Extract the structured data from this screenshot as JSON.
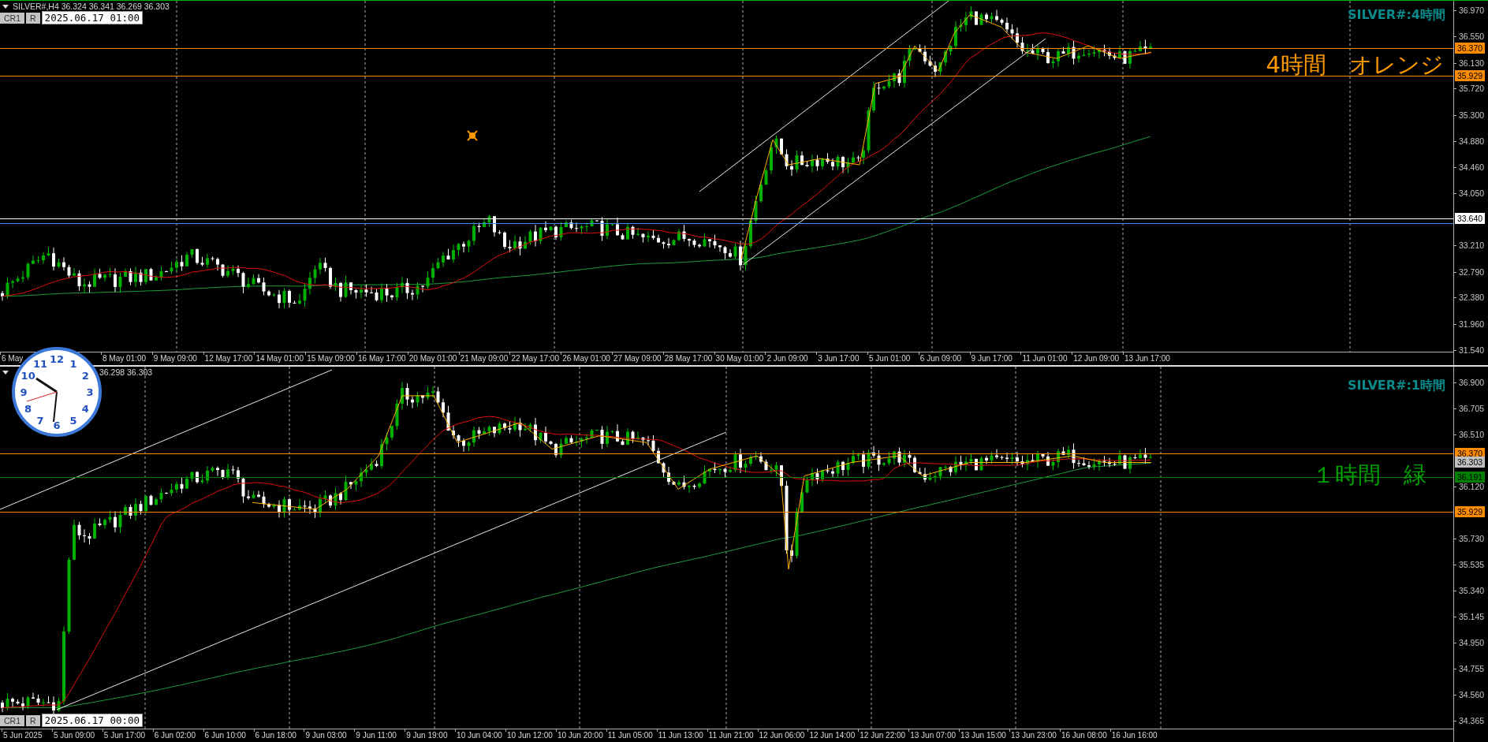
{
  "charts": [
    {
      "header": {
        "text": "SILVER#,H4 36.324 36.341 36.269 36.303"
      },
      "date_bar": {
        "buttons": [
          "CR1",
          "R"
        ],
        "value": "2025.06.17 01:00"
      },
      "title": "SILVER#:4時間",
      "note": {
        "text": "4時間　オレンジ",
        "color": "#ff9900"
      },
      "price_ticks": [
        "36.970",
        "36.550",
        "36.130",
        "35.720",
        "35.300",
        "34.880",
        "34.460",
        "34.050",
        "33.210",
        "32.790",
        "32.380",
        "31.960",
        "31.540"
      ],
      "price_labels": [
        {
          "text": "36.370",
          "color": "#ff8c00",
          "line": true
        },
        {
          "text": "35.929",
          "color": "#ff8c00",
          "line": true
        },
        {
          "text": "33.640",
          "color": "#ffffff",
          "line": true
        }
      ],
      "time_labels": [
        "6 May",
        "8 May 01:00",
        "9 May 09:00",
        "12 May 17:00",
        "14 May 01:00",
        "15 May 09:00",
        "16 May 17:00",
        "20 May 01:00",
        "21 May 09:00",
        "22 May 17:00",
        "26 May 01:00",
        "27 May 09:00",
        "28 May 17:00",
        "30 May 01:00",
        "2 Jun 09:00",
        "3 Jun 17:00",
        "5 Jun 01:00",
        "6 Jun 09:00",
        "9 Jun 17:00",
        "11 Jun 01:00",
        "12 Jun 09:00",
        "13 Jun 17:00"
      ]
    },
    {
      "header": {
        "text": "36.298 36.303"
      },
      "date_bar": {
        "buttons": [
          "CR1",
          "R"
        ],
        "value": "2025.06.17 00:00"
      },
      "title": "SILVER#:1時間",
      "note": {
        "text": "１時間　緑",
        "color": "#00a000"
      },
      "price_ticks": [
        "36.900",
        "36.705",
        "36.510",
        "36.120",
        "35.730",
        "35.535",
        "35.340",
        "35.145",
        "34.950",
        "34.755",
        "34.560",
        "34.365"
      ],
      "price_labels": [
        {
          "text": "36.370",
          "color": "#ff8c00",
          "line": true
        },
        {
          "text": "36.303",
          "color": "#c0c0c0",
          "line": false
        },
        {
          "text": "36.191",
          "color": "#008000",
          "line": true
        },
        {
          "text": "35.929",
          "color": "#ff8c00",
          "line": true
        }
      ],
      "time_labels": [
        "5 Jun 2025",
        "5 Jun 09:00",
        "5 Jun 17:00",
        "6 Jun 02:00",
        "6 Jun 10:00",
        "6 Jun 18:00",
        "9 Jun 03:00",
        "9 Jun 11:00",
        "9 Jun 19:00",
        "10 Jun 04:00",
        "10 Jun 12:00",
        "10 Jun 20:00",
        "11 Jun 05:00",
        "11 Jun 13:00",
        "11 Jun 21:00",
        "12 Jun 06:00",
        "12 Jun 14:00",
        "12 Jun 22:00",
        "13 Jun 07:00",
        "13 Jun 15:00",
        "13 Jun 23:00",
        "16 Jun 08:00",
        "16 Jun 16:00"
      ]
    }
  ],
  "clock": {
    "numerals": [
      "12",
      "11",
      "1",
      "10",
      "2",
      "9",
      "3",
      "8",
      "4",
      "7",
      "5",
      "6"
    ]
  }
}
